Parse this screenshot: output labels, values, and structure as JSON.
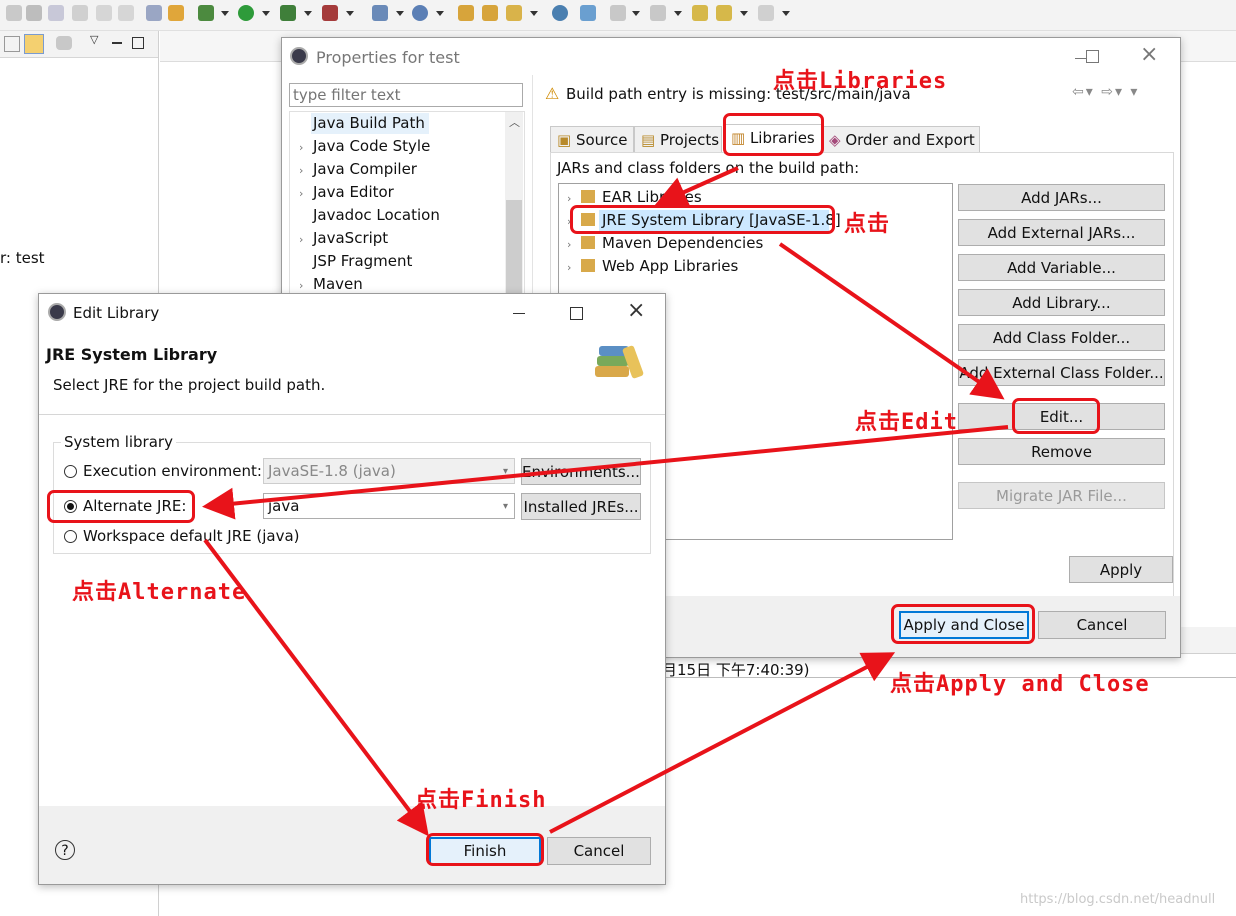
{
  "left_panel": {
    "label": "r: test"
  },
  "properties": {
    "title": "Properties for test",
    "filter_placeholder": "type filter text",
    "nav_items": [
      "Java Build Path",
      "Java Code Style",
      "Java Compiler",
      "Java Editor",
      "Javadoc Location",
      "JavaScript",
      "JSP Fragment",
      "Maven"
    ],
    "warning": "Build path entry is missing: test/src/main/java",
    "tabs": [
      "Source",
      "Projects",
      "Libraries",
      "Order and Export"
    ],
    "list_label": "JARs and class folders on the build path:",
    "libraries": [
      "EAR Libraries",
      "JRE System Library [JavaSE-1.8]",
      "Maven Dependencies",
      "Web App Libraries"
    ],
    "buttons": [
      "Add JARs...",
      "Add External JARs...",
      "Add Variable...",
      "Add Library...",
      "Add Class Folder...",
      "Add External Class Folder...",
      "Edit...",
      "Remove",
      "Migrate JAR File..."
    ],
    "apply": "Apply",
    "apply_close": "Apply and Close",
    "cancel": "Cancel"
  },
  "console_text": "月15日 下午7:40:39)",
  "edit_library": {
    "title": "Edit Library",
    "heading": "JRE System Library",
    "description": "Select JRE for the project build path.",
    "group_label": "System library",
    "exec_env_label": "Execution environment:",
    "exec_env_value": "JavaSE-1.8 (java)",
    "environments_button": "Environments...",
    "alternate_label": "Alternate JRE:",
    "alternate_value": "java",
    "installed_button": "Installed JREs...",
    "workspace_label": "Workspace default JRE (java)",
    "finish": "Finish",
    "cancel": "Cancel",
    "help": "?"
  },
  "annotations": {
    "libraries": "点击Libraries",
    "click": "点击",
    "edit": "点击Edit",
    "alternate": "点击Alternate",
    "finish": "点击Finish",
    "apply_close": "点击Apply and Close"
  },
  "watermark": "https://blog.csdn.net/headnull",
  "colors": {
    "annotation_red": "#e8131a",
    "focus_blue": "#0078d7"
  }
}
